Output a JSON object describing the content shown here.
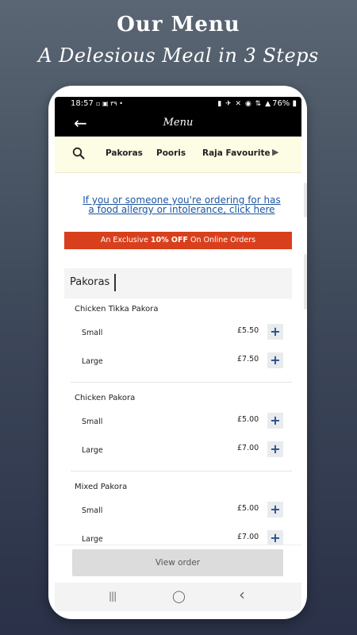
{
  "promo": {
    "title": "Our Menu",
    "subtitle": "A Delesious Meal in 3 Steps"
  },
  "status_bar": {
    "time": "18:57",
    "left_icons": "▫ ▣ ٣٩ •",
    "right_icons": "▮ ✈ ✕ ◉ ⇅ ▲",
    "battery": "76% ▮"
  },
  "app_bar": {
    "back_icon": "←",
    "title": "Menu"
  },
  "categories": {
    "tabs": [
      "Pakoras",
      "Pooris",
      "Raja Favourite"
    ],
    "next_icon": "▶"
  },
  "allergy_link": "If you or someone you're ordering for has a food allergy or intolerance, click here",
  "offer_banner": {
    "prefix": "An Exclusive ",
    "highlight": "10% OFF",
    "suffix": " On Online Orders",
    "color": "#d8401d"
  },
  "section": {
    "title": "Pakoras"
  },
  "menu_items": [
    {
      "name": "Chicken Tikka Pakora",
      "sizes": [
        {
          "size": "Small",
          "price": "£5.50"
        },
        {
          "size": "Large",
          "price": "£7.50"
        }
      ]
    },
    {
      "name": "Chicken Pakora",
      "sizes": [
        {
          "size": "Small",
          "price": "£5.00"
        },
        {
          "size": "Large",
          "price": "£7.00"
        }
      ]
    },
    {
      "name": "Mixed Pakora",
      "sizes": [
        {
          "size": "Small",
          "price": "£5.00"
        },
        {
          "size": "Large",
          "price": "£7.00"
        }
      ]
    }
  ],
  "add_icon": "+",
  "view_order_label": "View order",
  "nav": {
    "recents_icon": "|||",
    "home_icon": "◯",
    "back_icon": "‹"
  }
}
